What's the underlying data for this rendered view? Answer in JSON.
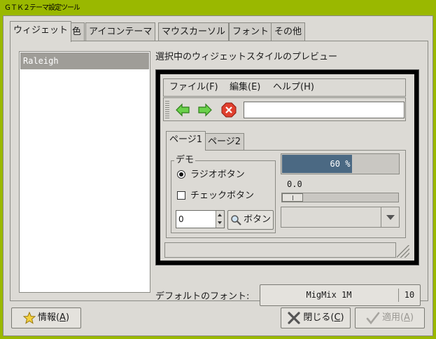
{
  "window": {
    "title": "ＧＴＫ２テーマ設定ツール"
  },
  "tabs": [
    {
      "label": "ウィジェット",
      "active": true
    },
    {
      "label": "色",
      "active": false
    },
    {
      "label": "アイコンテーマ",
      "active": false
    },
    {
      "label": "マウスカーソル",
      "active": false
    },
    {
      "label": "フォント",
      "active": false
    },
    {
      "label": "その他",
      "active": false
    }
  ],
  "theme_list": {
    "items": [
      "Raleigh"
    ],
    "selected": "Raleigh"
  },
  "preview": {
    "label": "選択中のウィジェットスタイルのプレビュー",
    "menu": [
      "ファイル(F)",
      "編集(E)",
      "ヘルプ(H)"
    ],
    "toolbar": {
      "icons": [
        "back-arrow-icon",
        "forward-arrow-icon",
        "stop-icon"
      ],
      "entry_value": ""
    },
    "inner_tabs": [
      {
        "label": "ページ1",
        "active": true
      },
      {
        "label": "ページ2",
        "active": false
      }
    ],
    "demo_frame": {
      "legend": "デモ",
      "radio_label": "ラジオボタン",
      "radio_checked": true,
      "check_label": "チェックボタン",
      "check_checked": false,
      "spin_value": "0",
      "button_label": "ボタン"
    },
    "progress": {
      "value": 60,
      "text": "60 %"
    },
    "scale": {
      "value": "0.0",
      "fraction": 0.0
    },
    "combo_value": "",
    "status_text": ""
  },
  "font": {
    "label": "デフォルトのフォント:",
    "name": "MigMix 1M",
    "size": "10"
  },
  "buttons": {
    "about": {
      "label": "情報(",
      "mnemonic": "A",
      "suffix": ")"
    },
    "close": {
      "label": "閉じる(",
      "mnemonic": "C",
      "suffix": ")"
    },
    "apply": {
      "label": "適用(",
      "mnemonic": "A",
      "suffix": ")",
      "enabled": false
    }
  },
  "colors": {
    "window_frame": "#9ab800",
    "background": "#dcdad5",
    "selection": "#9f9d98",
    "progress": "#4b6983",
    "back_arrow": "#4caf28",
    "stop": "#d42a1e"
  }
}
